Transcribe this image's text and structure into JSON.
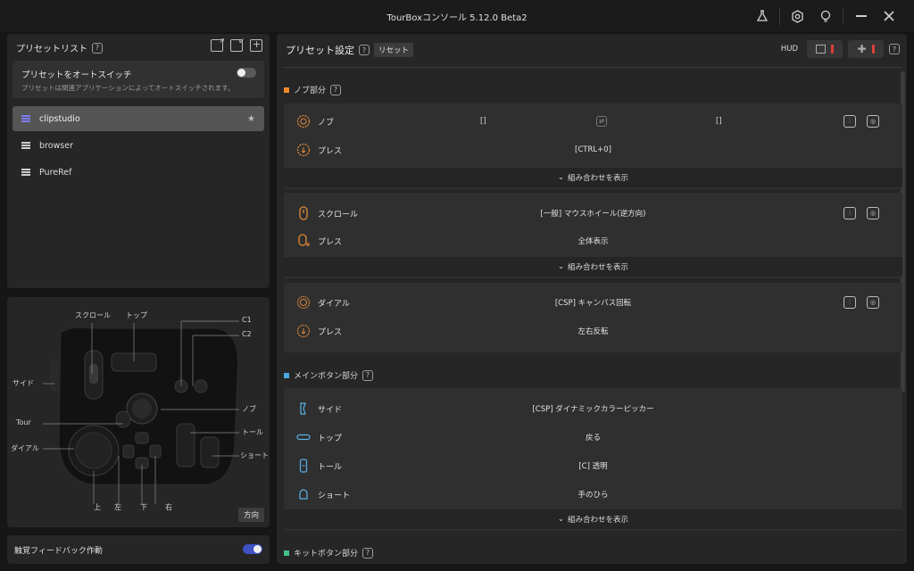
{
  "app": {
    "title": "TourBoxコンソール 5.12.0 Beta2"
  },
  "preset_list": {
    "title": "プリセットリスト",
    "auto_switch_title": "プリセットをオートスイッチ",
    "auto_switch_sub": "プリセットは関連アプリケーションによってオートスイッチされます。",
    "items": [
      {
        "label": "clipstudio",
        "active": true
      },
      {
        "label": "browser",
        "active": false
      },
      {
        "label": "PureRef",
        "active": false
      }
    ]
  },
  "diagram": {
    "labels": {
      "scroll": "スクロール",
      "top": "トップ",
      "c1": "C1",
      "c2": "C2",
      "side": "サイド",
      "tour": "Tour",
      "knob": "ノブ",
      "tall": "トール",
      "dial": "ダイアル",
      "short": "ショート",
      "up": "上",
      "left": "左",
      "down": "下",
      "right": "右"
    },
    "direction_button": "方向"
  },
  "haptic": {
    "label": "触覚フィードバック作動",
    "enabled": true
  },
  "settings": {
    "title": "プリセット設定",
    "reset_label": "リセット",
    "hud_label": "HUD",
    "combo_label": "組み合わせを表示",
    "sections": {
      "knob": {
        "title": "ノブ部分",
        "color": "#f08a2b"
      },
      "main": {
        "title": "メインボタン部分",
        "color": "#4aa8e0"
      },
      "kit": {
        "title": "キットボタン部分",
        "color": "#45c08a"
      }
    },
    "knob_card": {
      "row1": {
        "label": "ノブ",
        "left": "[]",
        "right": "[]"
      },
      "row2": {
        "label": "プレス",
        "value": "[CTRL+0]"
      }
    },
    "scroll_card": {
      "row1": {
        "label": "スクロール",
        "value": "[一般] マウスホイール(逆方向)"
      },
      "row2": {
        "label": "プレス",
        "value": "全体表示"
      }
    },
    "dial_card": {
      "row1": {
        "label": "ダイアル",
        "value": "[CSP] キャンバス回転"
      },
      "row2": {
        "label": "プレス",
        "value": "左右反転"
      }
    },
    "main_card": {
      "rows": [
        {
          "label": "サイド",
          "value": "[CSP] ダイナミックカラーピッカー"
        },
        {
          "label": "トップ",
          "value": "戻る"
        },
        {
          "label": "トール",
          "value": "[C] 透明"
        },
        {
          "label": "ショート",
          "value": "手のひら"
        }
      ]
    }
  }
}
